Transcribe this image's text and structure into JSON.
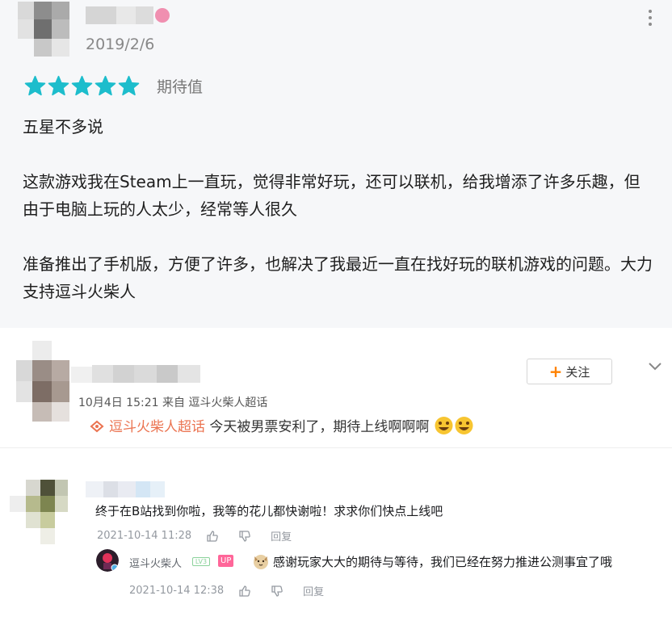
{
  "review": {
    "date": "2019/2/6",
    "rating_stars": 5,
    "rating_label": "期待值",
    "star_color": "#1dbdcc",
    "paragraphs": [
      "五星不多说",
      "这款游戏我在Steam上一直玩，觉得非常好玩，还可以联机，给我增添了许多乐趣，但由于电脑上玩的人太少，经常等人很久",
      "准备推出了手机版，方便了许多，也解决了我最近一直在找好玩的联机游戏的问题。大力支持逗斗火柴人"
    ]
  },
  "weibo": {
    "follow_label": "关注",
    "follow_plus": "+",
    "meta_time": "10月4日 15:21",
    "meta_from": "来自",
    "meta_source": "逗斗火柴人超话",
    "topic": "逗斗火柴人超话",
    "text": " 今天被男票安利了，期待上线啊啊啊",
    "topic_color": "#eb7350",
    "follow_accent": "#ff8200"
  },
  "bilibili": {
    "comment": {
      "text": "终于在B站找到你啦，我等的花儿都快谢啦！求求你们快点上线吧",
      "time": "2021-10-14 11:28",
      "reply_label": "回复"
    },
    "reply": {
      "username": "逗斗火柴人",
      "level_badge": "LV3",
      "up_badge": "UP",
      "text": "感谢玩家大大的期待与等待，我们已经在努力推进公测事宜了哦",
      "time": "2021-10-14 12:38",
      "reply_label": "回复"
    },
    "up_color": "#ff6699",
    "meta_color": "#9499a0"
  }
}
